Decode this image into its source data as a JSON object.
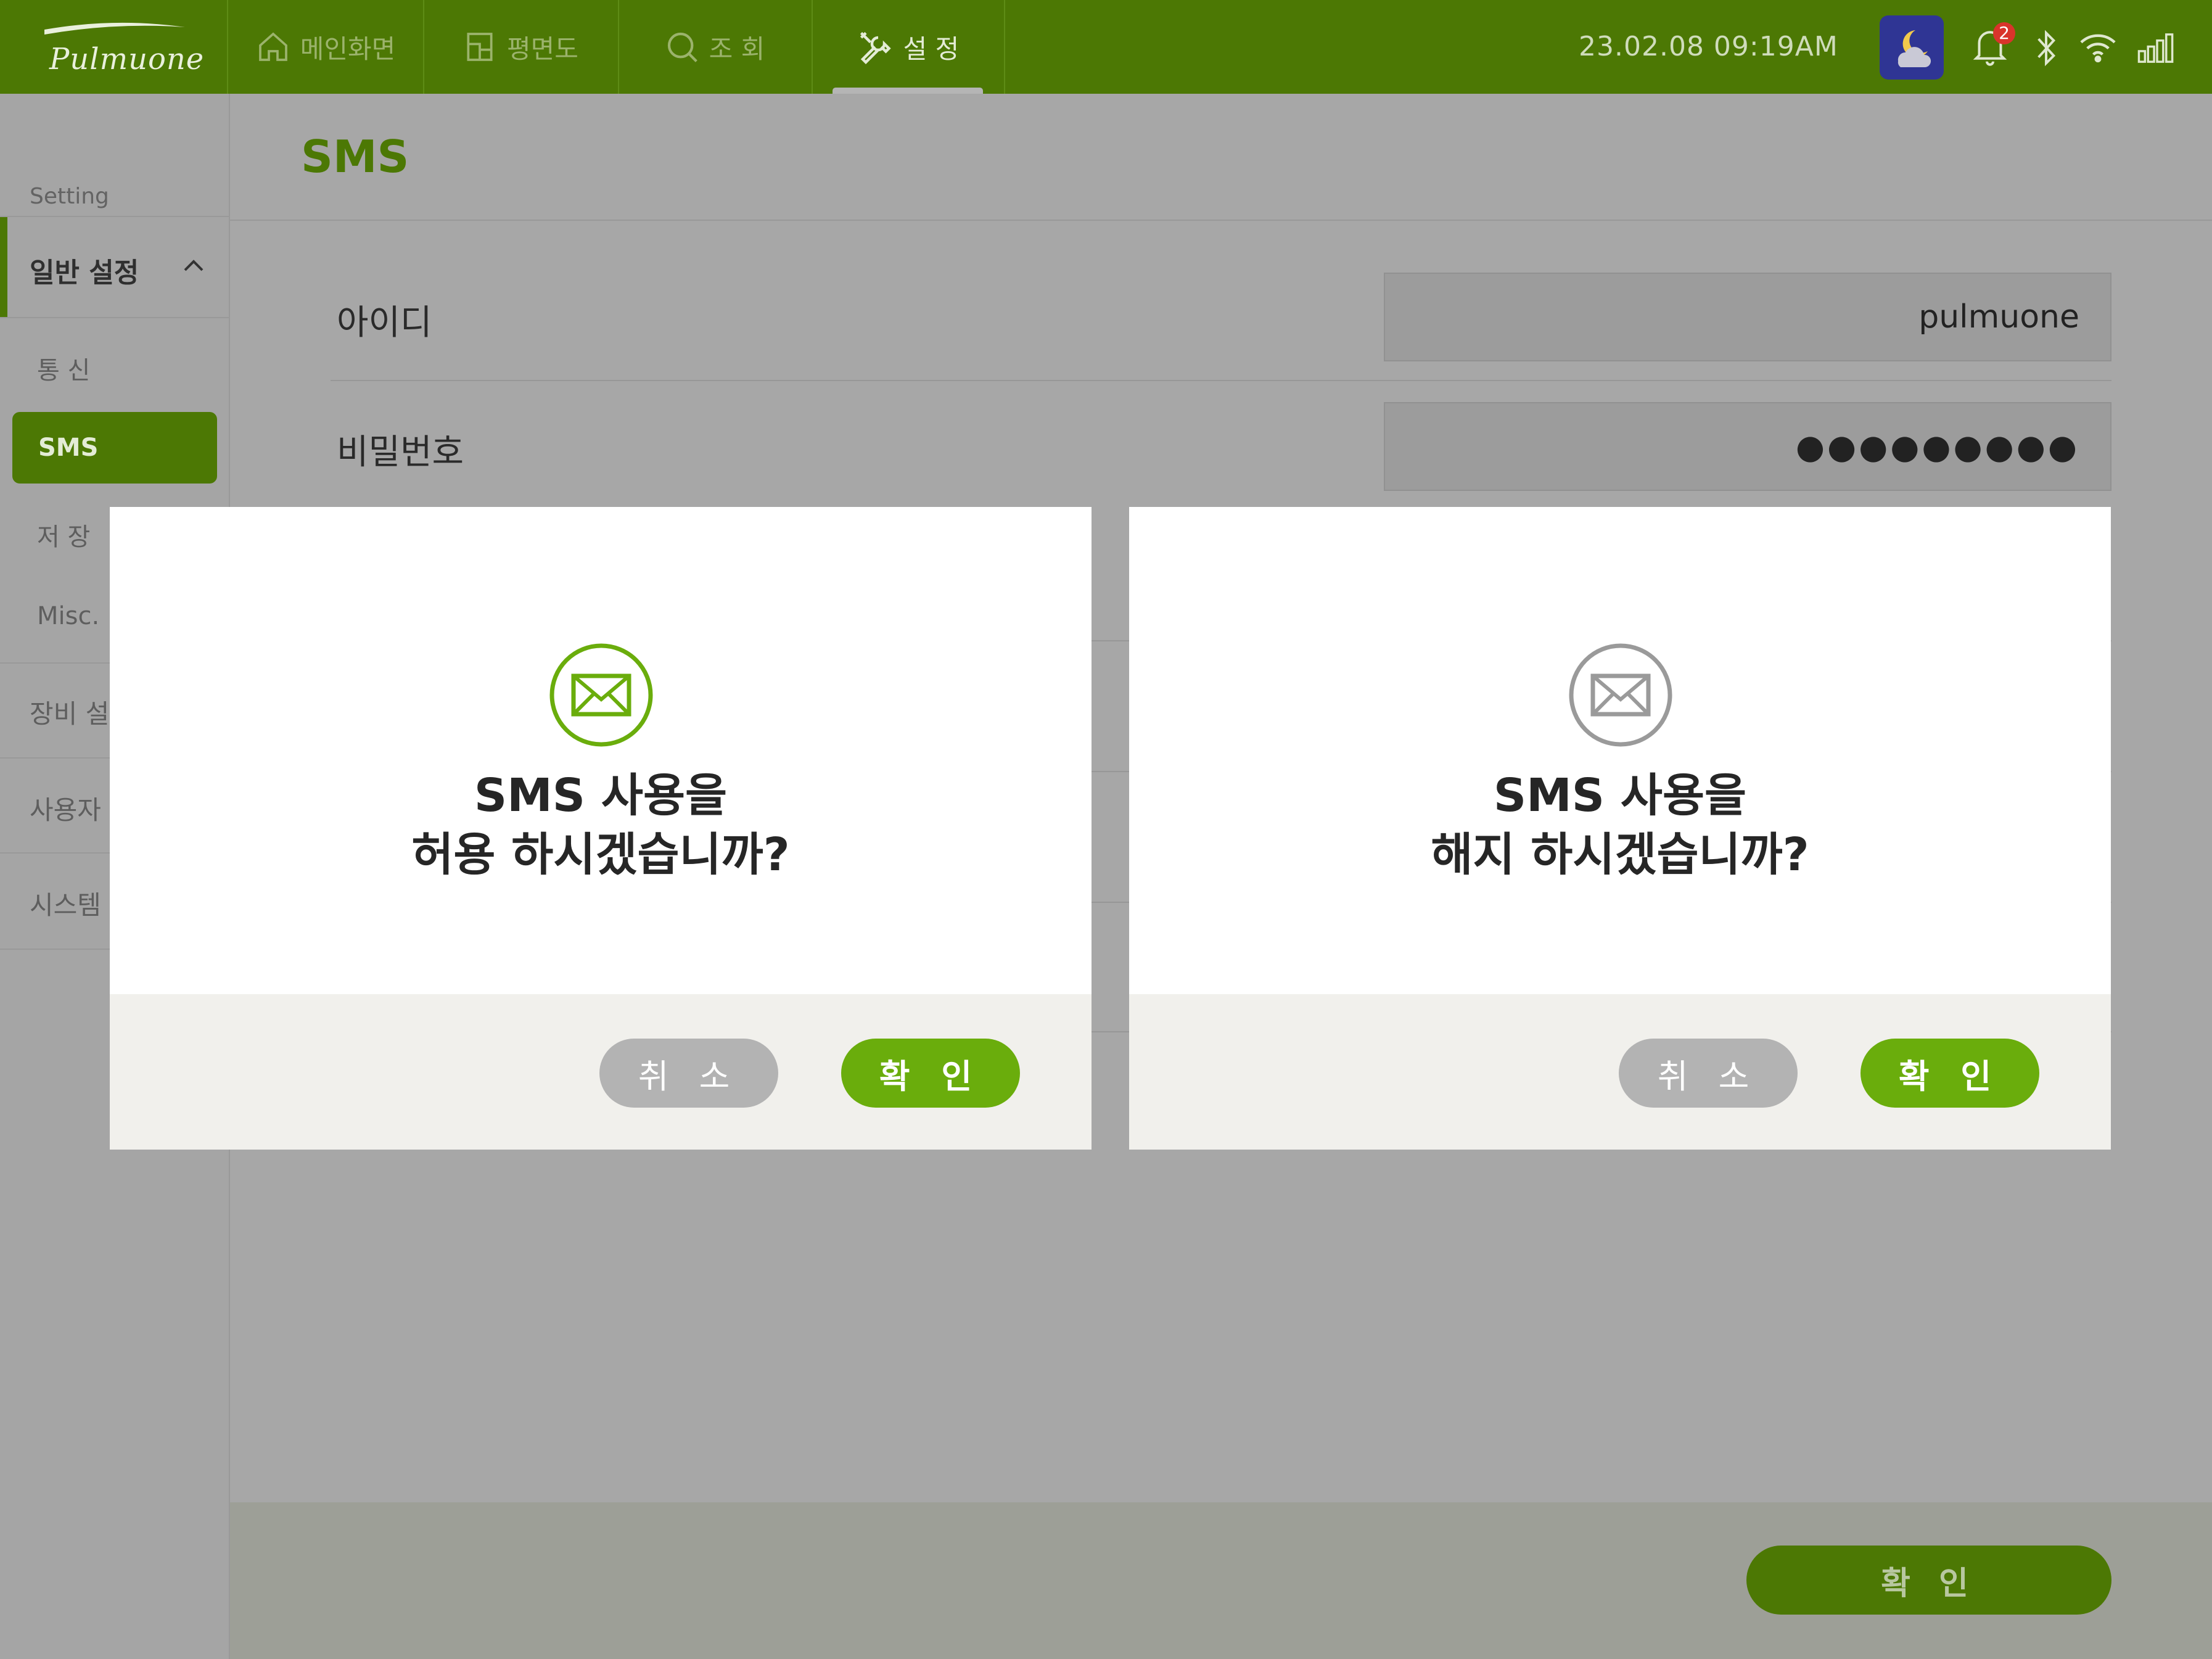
{
  "app": {
    "logo_text": "Pulmuone"
  },
  "topnav": {
    "items": [
      {
        "label": "메인화면",
        "icon": "home-icon"
      },
      {
        "label": "평면도",
        "icon": "floorplan-icon"
      },
      {
        "label": "조 회",
        "icon": "search-icon"
      },
      {
        "label": "설 정",
        "icon": "tools-icon",
        "active": true
      }
    ]
  },
  "status": {
    "datetime": "23.02.08  09:19AM",
    "weather_icon": "night-cloud-icon",
    "notification_count": "2",
    "icons": [
      "bell-icon",
      "bluetooth-icon",
      "wifi-icon",
      "signal-icon"
    ]
  },
  "sidebar": {
    "caption": "Setting",
    "group_label": "일반 설정",
    "sub_items": [
      "통 신",
      "SMS",
      "저 장",
      "Misc."
    ],
    "selected": "SMS",
    "main_items": [
      "장비 설정",
      "사용자",
      "시스템"
    ]
  },
  "page": {
    "title": "SMS",
    "fields": [
      {
        "label": "아이디",
        "value": "pulmuone"
      },
      {
        "label": "비밀번호",
        "value": "●●●●●●●●●"
      }
    ],
    "confirm_label": "확 인"
  },
  "dialogs": [
    {
      "icon": "envelope-icon",
      "icon_color": "#6aad0c",
      "line1": "SMS 사용을",
      "line2": "허용 하시겠습니까?",
      "cancel_label": "취 소",
      "ok_label": "확 인"
    },
    {
      "icon": "envelope-icon",
      "icon_color": "#9a9a9a",
      "line1": "SMS 사용을",
      "line2": "해지 하시겠습니까?",
      "cancel_label": "취 소",
      "ok_label": "확 인"
    }
  ],
  "colors": {
    "brand": "#4c7804",
    "accent": "#6aad0c",
    "overlay_bg": "#a7a7a7"
  }
}
